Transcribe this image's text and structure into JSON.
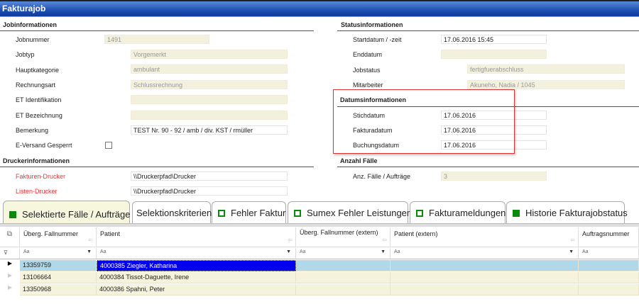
{
  "window": {
    "title": "Fakturajob"
  },
  "jobinfo": {
    "title": "Jobinformationen",
    "fields": [
      {
        "label": "Jobnummer",
        "value": "1491"
      },
      {
        "label": "Jobtyp",
        "value": "Vorgemerkt"
      },
      {
        "label": "Hauptkategorie",
        "value": "ambulant"
      },
      {
        "label": "Rechnungsart",
        "value": "Schlussrechnung"
      },
      {
        "label": "ET Identifikation",
        "value": ""
      },
      {
        "label": "ET Bezeichnung",
        "value": ""
      },
      {
        "label": "Bemerkung",
        "value": "TEST Nr. 90 - 92 / amb / div. KST / rmüller"
      },
      {
        "label": "E-Versand Gesperrt",
        "checked": false
      }
    ]
  },
  "drucker": {
    "title": "Druckerinformationen",
    "fields": [
      {
        "label": "Fakturen-Drucker",
        "value": "\\\\Druckerpfad\\Drucker"
      },
      {
        "label": "Listen-Drucker",
        "value": "\\\\Druckerpfad\\Drucker"
      }
    ]
  },
  "status": {
    "title": "Statusinformationen",
    "fields": [
      {
        "label": "Startdatum / -zeit",
        "value": "17.06.2016 15:45"
      },
      {
        "label": "Enddatum",
        "value": ""
      },
      {
        "label": "Jobstatus",
        "value": "fertigfuerabschluss"
      },
      {
        "label": "Mitarbeiter",
        "value": "Akuneho, Nadia / 1045"
      }
    ]
  },
  "datum": {
    "title": "Datumsinformationen",
    "highlight_color": "#dd3333",
    "fields": [
      {
        "label": "Stichdatum",
        "value": "17.06.2016"
      },
      {
        "label": "Fakturadatum",
        "value": "17.06.2016"
      },
      {
        "label": "Buchungsdatum",
        "value": "17.06.2016"
      }
    ]
  },
  "anzahl": {
    "title": "Anzahl Fälle",
    "fields": [
      {
        "label": "Anz. Fälle / Aufträge",
        "value": "3"
      }
    ]
  },
  "tabs": [
    {
      "label": "Selektierte Fälle / Aufträge",
      "icon": "filled-square",
      "active": true
    },
    {
      "label": "Selektionskriterien",
      "icon": "none"
    },
    {
      "label": "Fehler Faktur",
      "icon": "empty-square"
    },
    {
      "label": "Sumex Fehler Leistungen",
      "icon": "empty-square"
    },
    {
      "label": "Fakturameldungen",
      "icon": "empty-square"
    },
    {
      "label": "Historie Fakturajobstatus",
      "icon": "filled-square"
    }
  ],
  "grid": {
    "columns": [
      "Überg. Fallnummer",
      "Patient",
      "Überg. Fallnummer (extern)",
      "Patient (extern)",
      "Auftragsnummer"
    ],
    "filter_placeholder": "Aa",
    "rows": [
      [
        "13359759",
        "4000385 Ziegler, Katharina",
        "",
        "",
        ""
      ],
      [
        "13106664",
        "4000384 Tissot-Daguette, Irene",
        "",
        "",
        ""
      ],
      [
        "13350968",
        "4000386 Spahni, Peter",
        "",
        "",
        ""
      ]
    ],
    "selected_row": 0
  }
}
